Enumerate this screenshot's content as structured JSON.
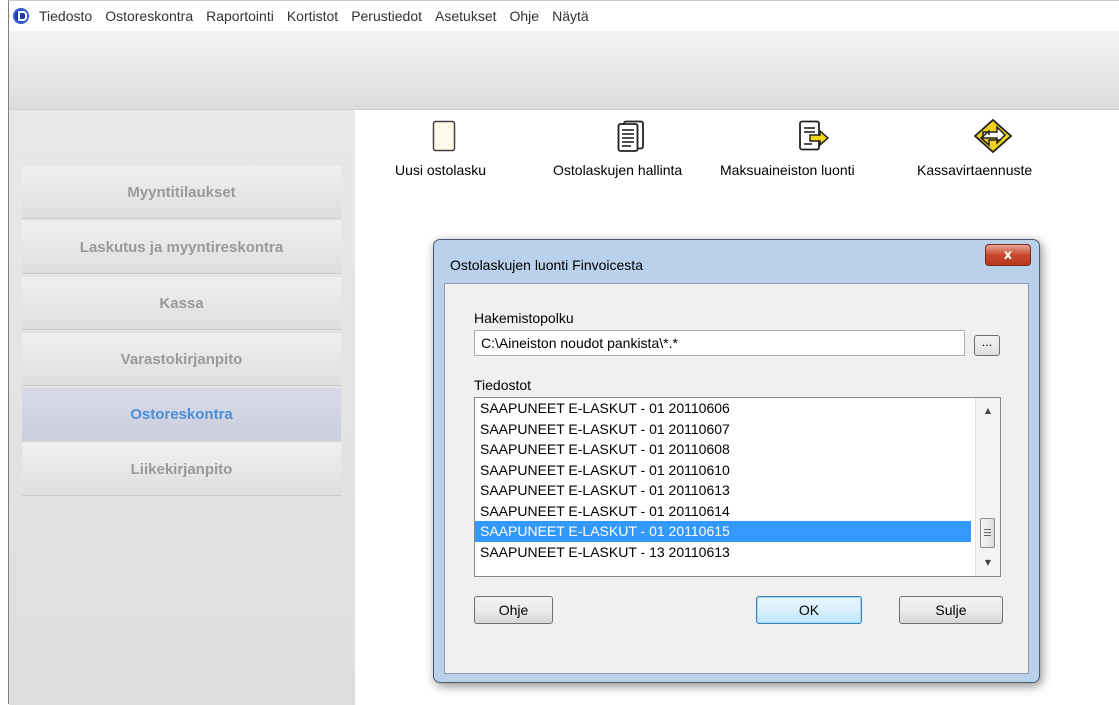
{
  "menu": [
    "Tiedosto",
    "Ostoreskontra",
    "Raportointi",
    "Kortistot",
    "Perustiedot",
    "Asetukset",
    "Ohje",
    "Näytä"
  ],
  "sidebar": {
    "items": [
      {
        "label": "Myyntitilaukset",
        "active": false
      },
      {
        "label": "Laskutus ja myyntireskontra",
        "active": false
      },
      {
        "label": "Kassa",
        "active": false
      },
      {
        "label": "Varastokirjanpito",
        "active": false
      },
      {
        "label": "Ostoreskontra",
        "active": true
      },
      {
        "label": "Liikekirjanpito",
        "active": false
      }
    ]
  },
  "shortcuts": [
    {
      "label": "Uusi ostolasku",
      "icon": "blank-document-icon"
    },
    {
      "label": "Ostolaskujen hallinta",
      "icon": "document-list-icon"
    },
    {
      "label": "Maksuaineiston luonti",
      "icon": "document-export-icon"
    },
    {
      "label": "Kassavirtaennuste",
      "icon": "cashflow-arrows-icon"
    }
  ],
  "dialog": {
    "title": "Ostolaskujen luonti Finvoicesta",
    "close_label": "x",
    "path_label": "Hakemistopolku",
    "path_value": "C:\\Aineiston noudot pankista\\*.*",
    "browse_label": "...",
    "files_label": "Tiedostot",
    "files": [
      "SAAPUNEET E-LASKUT - 01 20110606",
      "SAAPUNEET E-LASKUT - 01 20110607",
      "SAAPUNEET E-LASKUT - 01 20110608",
      "SAAPUNEET E-LASKUT - 01 20110610",
      "SAAPUNEET E-LASKUT - 01 20110613",
      "SAAPUNEET E-LASKUT - 01 20110614",
      "SAAPUNEET E-LASKUT - 01 20110615",
      "SAAPUNEET E-LASKUT - 13 20110613"
    ],
    "selected_index": 6,
    "help_button": "Ohje",
    "ok_button": "OK",
    "close_button": "Sulje"
  },
  "colors": {
    "active_nav_text": "#4d8fd6",
    "selection": "#3399ff",
    "dialog_frame": "#b9d1ea"
  }
}
